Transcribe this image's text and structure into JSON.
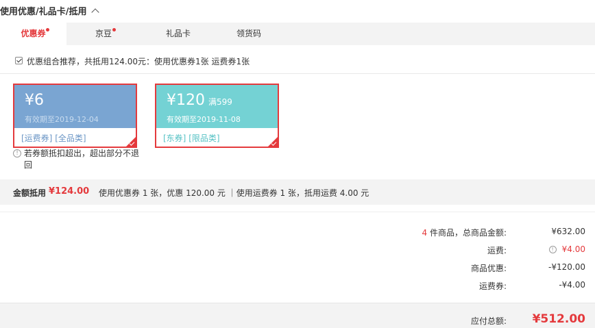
{
  "section": {
    "title": "使用优惠/礼品卡/抵用"
  },
  "tabs": [
    {
      "label": "优惠券",
      "active": true,
      "badge": true
    },
    {
      "label": "京豆",
      "active": false,
      "badge": true
    },
    {
      "label": "礼品卡",
      "active": false,
      "badge": false
    },
    {
      "label": "领货码",
      "active": false,
      "badge": false
    }
  ],
  "combo": {
    "checked": true,
    "text": "优惠组合推荐，共抵用124.00元：使用优惠券1张 运费券1张"
  },
  "coupons": [
    {
      "amount": "¥6",
      "condition": "",
      "valid": "有效期至2019-12-04",
      "tags": [
        "[运费券]",
        "[全品类]"
      ],
      "face_color": "#7aa5d2",
      "valid_color": "#c9dcef",
      "tag_color": "#6a95c5",
      "selected": true
    },
    {
      "amount": "¥120",
      "condition": "满599",
      "valid": "有效期至2019-11-08",
      "tags": [
        "[东券]",
        "[限品类]"
      ],
      "face_color": "#74d2d4",
      "valid_color": "#ffffff",
      "tag_color": "#55c1c4",
      "selected": true
    }
  ],
  "note": {
    "text": "若券额抵扣超出，超出部分不退回"
  },
  "summary": {
    "label": "金额抵用",
    "amount": "¥124.00",
    "detail": "使用优惠券 1 张，优惠 120.00 元 ｜使用运费券 1 张，抵用运费 4.00 元"
  },
  "totals": {
    "goods_count": "4",
    "goods_label": " 件商品，总商品金额:",
    "goods_value": "¥632.00",
    "shipping_label": "运费:",
    "shipping_value": "¥4.00",
    "discount_label": "商品优惠:",
    "discount_value": "-¥120.00",
    "shipping_coupon_label": "运费券:",
    "shipping_coupon_value": "-¥4.00"
  },
  "payable": {
    "label": "应付总额:",
    "value": "¥512.00"
  },
  "colors": {
    "accent": "#e4393c",
    "shipping_fee": "#e4393c"
  }
}
